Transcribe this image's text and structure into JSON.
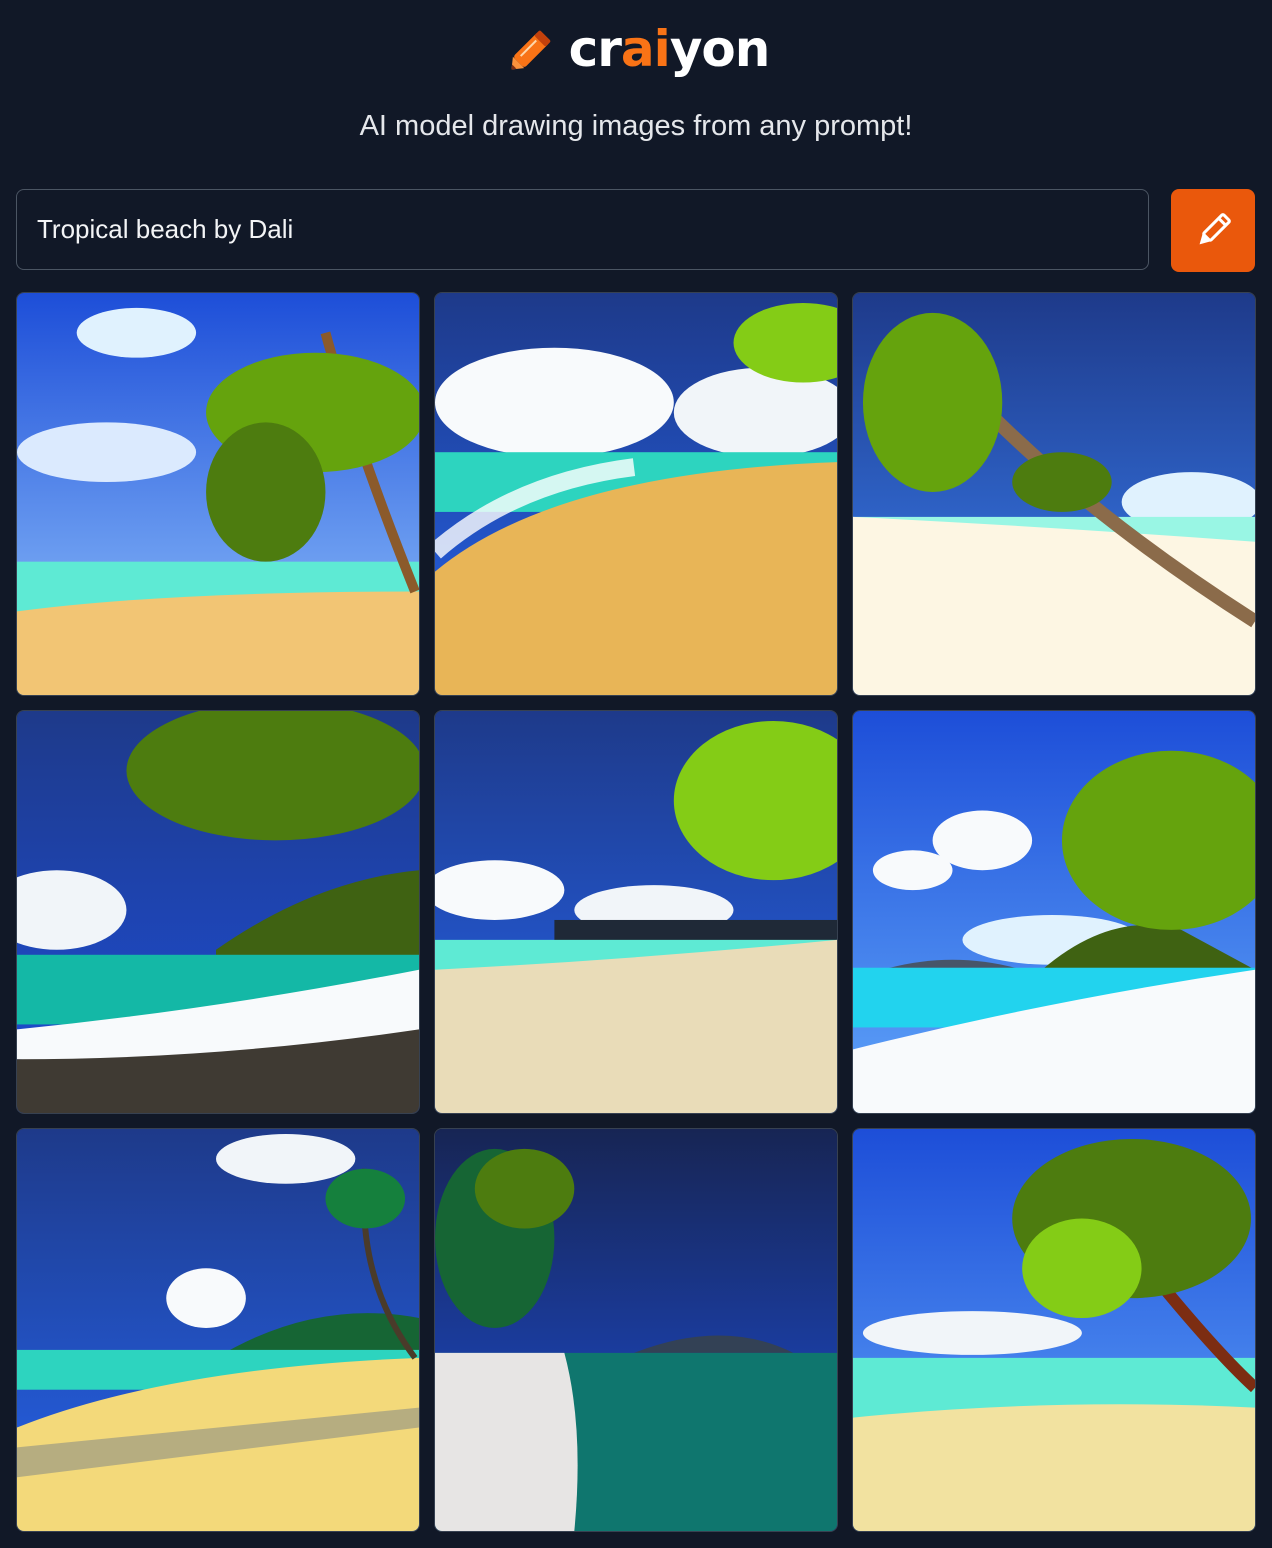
{
  "brand": {
    "name_pre": "cr",
    "name_accent": "ai",
    "name_post": "yon",
    "logo_icon": "crayon-icon",
    "accent_color": "#f97316"
  },
  "tagline": "AI model drawing images from any prompt!",
  "prompt": {
    "value": "Tropical beach by Dali",
    "placeholder": ""
  },
  "draw_button": {
    "icon": "pencil-icon",
    "color": "#ea580c"
  },
  "images": [
    {
      "id": "image-1"
    },
    {
      "id": "image-2"
    },
    {
      "id": "image-3"
    },
    {
      "id": "image-4"
    },
    {
      "id": "image-5"
    },
    {
      "id": "image-6"
    },
    {
      "id": "image-7"
    },
    {
      "id": "image-8"
    },
    {
      "id": "image-9"
    }
  ]
}
